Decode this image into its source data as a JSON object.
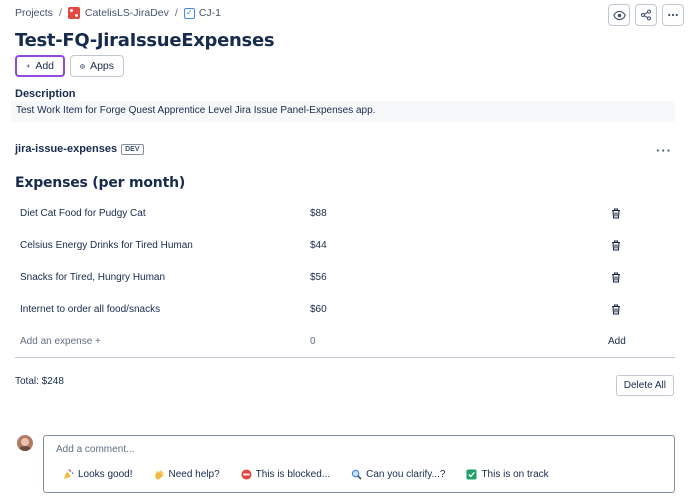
{
  "breadcrumb": {
    "projects": "Projects",
    "project": "CatelisLS-JiraDev",
    "issue": "CJ-1"
  },
  "title": "Test-FQ-JiraIssueExpenses",
  "buttons": {
    "add": "Add",
    "apps": "Apps"
  },
  "description": {
    "label": "Description",
    "text": "Test Work Item for Forge Quest Apprentice Level Jira Issue Panel-Expenses app."
  },
  "panel": {
    "title": "jira-issue-expenses",
    "badge": "DEV",
    "heading": "Expenses (per month)",
    "expenses": [
      {
        "name": "Diet Cat Food for Pudgy Cat",
        "amount": "$88"
      },
      {
        "name": "Celsius Energy Drinks for Tired Human",
        "amount": "$44"
      },
      {
        "name": "Snacks for Tired, Hungry Human",
        "amount": "$56"
      },
      {
        "name": "Internet to order all food/snacks",
        "amount": "$60"
      }
    ],
    "new_expense": {
      "placeholder": "Add an expense +",
      "amount": "0",
      "action": "Add"
    },
    "total": "Total: $248",
    "delete_all": "Delete All"
  },
  "comment": {
    "placeholder": "Add a comment...",
    "quick_replies": [
      {
        "icon": "party-popper-icon",
        "label": "Looks good!"
      },
      {
        "icon": "waving-hand-icon",
        "label": "Need help?"
      },
      {
        "icon": "no-entry-icon",
        "label": "This is blocked..."
      },
      {
        "icon": "magnifier-icon",
        "label": "Can you clarify...?"
      },
      {
        "icon": "check-mark-icon",
        "label": "This is on track"
      }
    ]
  },
  "colors": {
    "accent": "#8f49de",
    "project_icon": "#e2483d",
    "task_icon": "#4688ec"
  }
}
